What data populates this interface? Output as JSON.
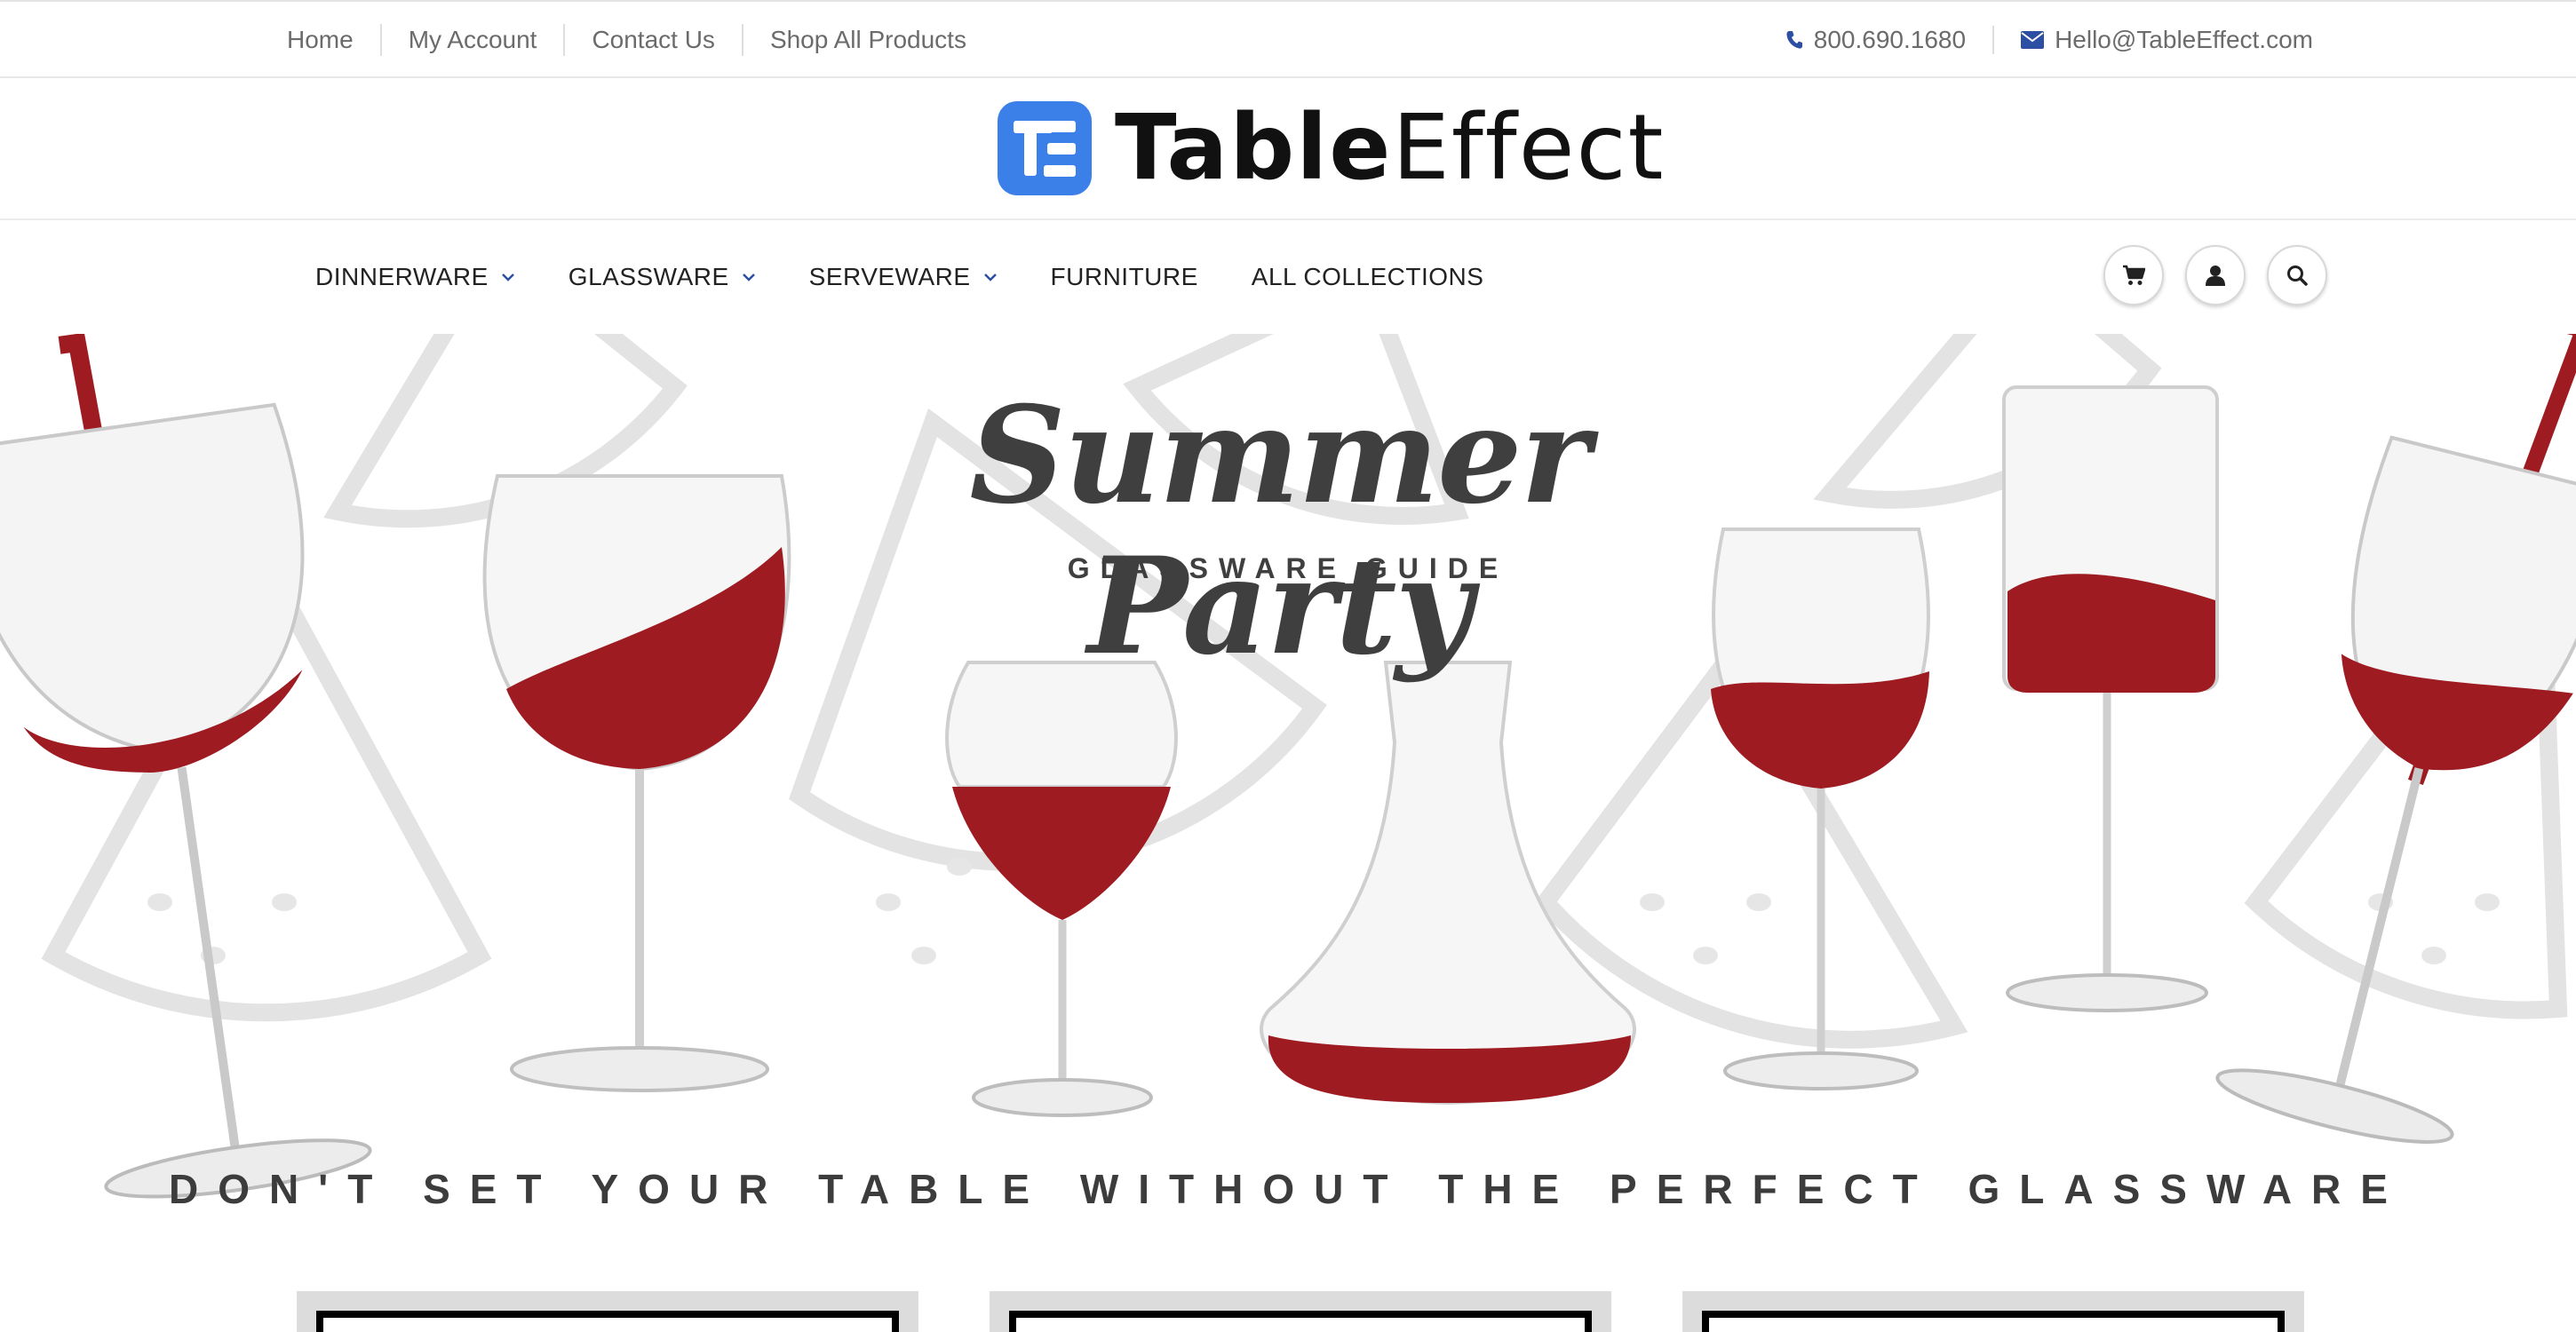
{
  "topbar": {
    "links": [
      "Home",
      "My Account",
      "Contact Us",
      "Shop All Products"
    ],
    "phone": "800.690.1680",
    "email": "Hello@TableEffect.com"
  },
  "logo": {
    "bold": "Table",
    "light": "Effect",
    "brand_color": "#3b7fe9"
  },
  "nav": {
    "items": [
      {
        "label": "DINNERWARE",
        "dropdown": true
      },
      {
        "label": "GLASSWARE",
        "dropdown": true
      },
      {
        "label": "SERVEWARE",
        "dropdown": true
      },
      {
        "label": "FURNITURE",
        "dropdown": false
      },
      {
        "label": "ALL COLLECTIONS",
        "dropdown": false
      }
    ],
    "icons": [
      "cart-icon",
      "account-icon",
      "search-icon"
    ],
    "accent": "#2d4fa3"
  },
  "hero": {
    "title": "Summer Party",
    "subtitle": "GLASSWARE GUIDE",
    "tagline": "DON'T SET YOUR TABLE WITHOUT THE PERFECT GLASSWARE",
    "wine_color": "#9e1b22"
  }
}
